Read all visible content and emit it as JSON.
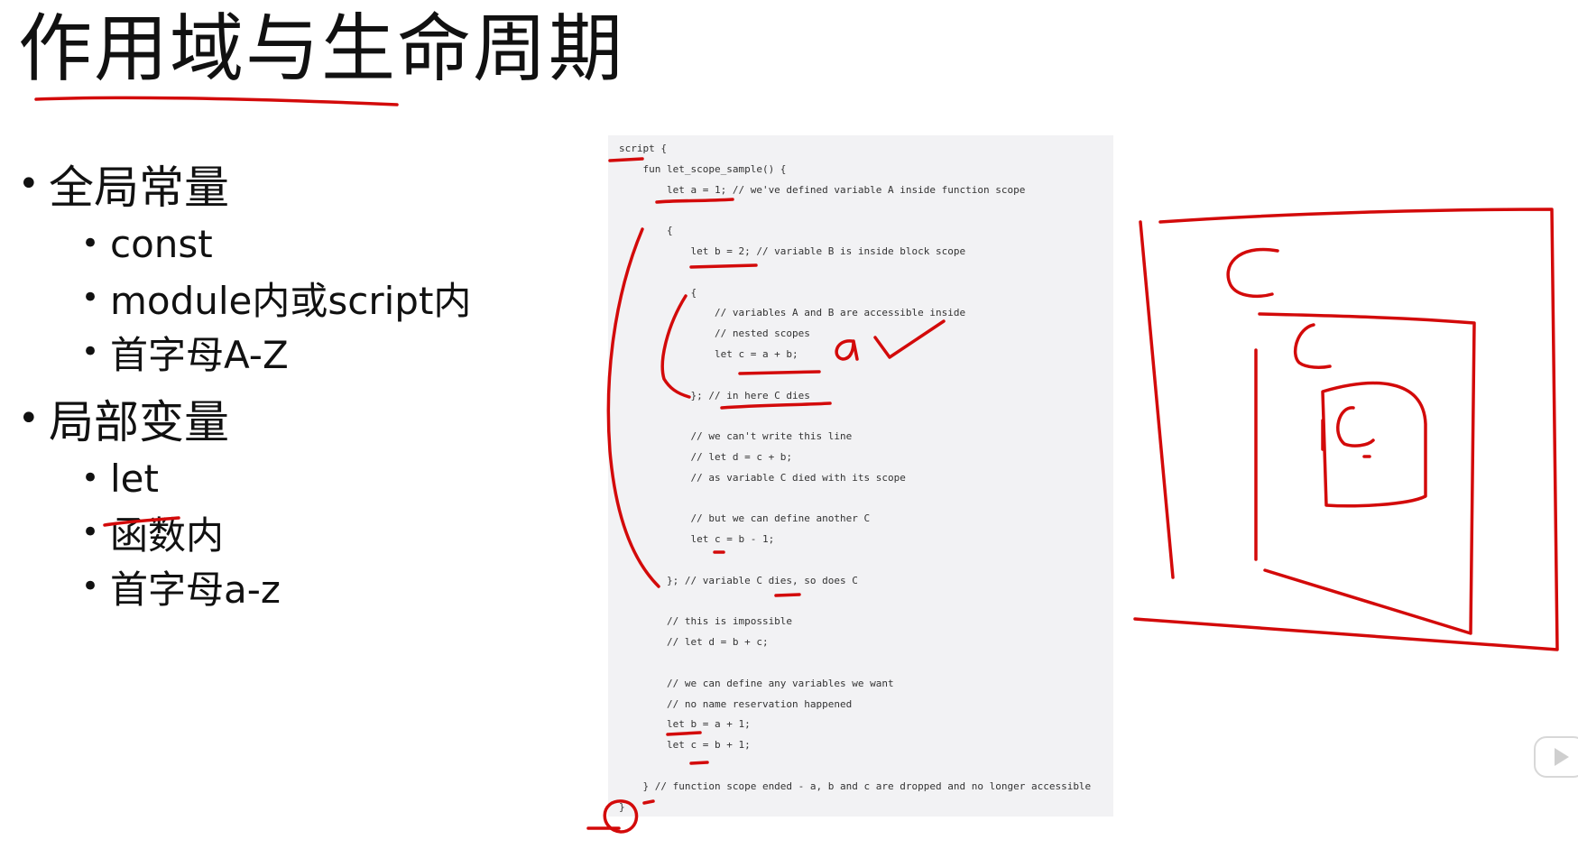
{
  "title": "作用域与生命周期",
  "sections": [
    {
      "heading": "全局常量",
      "items": [
        "const",
        "module内或script内",
        "首字母A-Z"
      ]
    },
    {
      "heading": "局部变量",
      "items": [
        "let",
        "函数内",
        "首字母a-z"
      ]
    }
  ],
  "bullet_glyph": "•",
  "code_lines": [
    "script {",
    "    fun let_scope_sample() {",
    "        let a = 1; // we've defined variable A inside function scope",
    "",
    "        {",
    "            let b = 2; // variable B is inside block scope",
    "",
    "            {",
    "                // variables A and B are accessible inside",
    "                // nested scopes",
    "                let c = a + b;",
    "",
    "            }; // in here C dies",
    "",
    "            // we can't write this line",
    "            // let d = c + b;",
    "            // as variable C died with its scope",
    "",
    "            // but we can define another C",
    "            let c = b - 1;",
    "",
    "        }; // variable C dies, so does C",
    "",
    "        // this is impossible",
    "        // let d = b + c;",
    "",
    "        // we can define any variables we want",
    "        // no name reservation happened",
    "        let b = a + 1;",
    "        let c = b + 1;",
    "",
    "    } // function scope ended - a, b and c are dropped and no longer accessible",
    "}"
  ],
  "annotations": {
    "outer_scope_label": "C",
    "middle_scope_label": "C",
    "inner_scope_label": "C",
    "handwritten_note": "a",
    "ink_color": "#d30a0a"
  },
  "icons": {
    "play": "play-icon"
  }
}
